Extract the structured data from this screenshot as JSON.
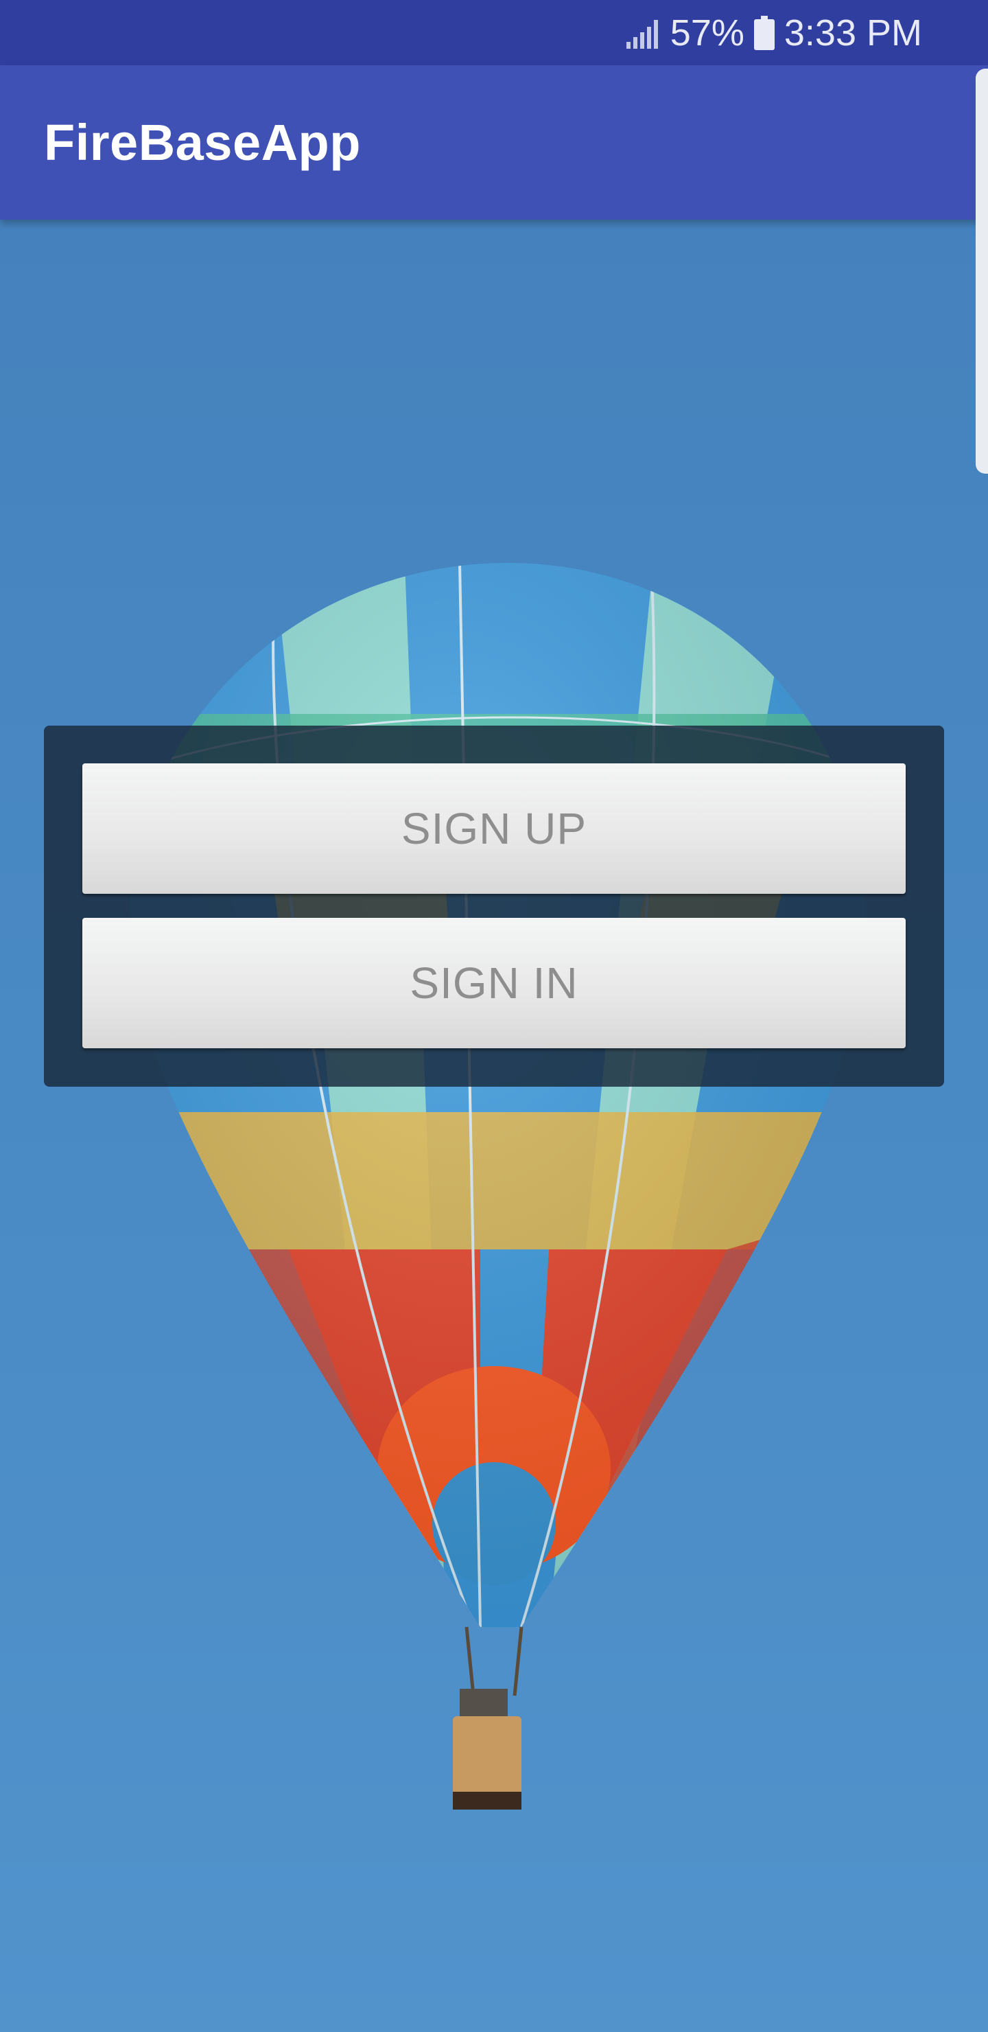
{
  "status_bar": {
    "signal_icon": "signal-strength-icon",
    "battery_percent": "57%",
    "battery_icon": "battery-icon",
    "time": "3:33 PM"
  },
  "app_bar": {
    "title": "FireBaseApp"
  },
  "auth": {
    "sign_up_label": "SIGN UP",
    "sign_in_label": "SIGN IN"
  },
  "colors": {
    "status_bar": "#303f9f",
    "app_bar": "#3f51b5",
    "sky": "#4a89c4",
    "panel": "#19283a",
    "button_text": "#8e8e8e"
  }
}
